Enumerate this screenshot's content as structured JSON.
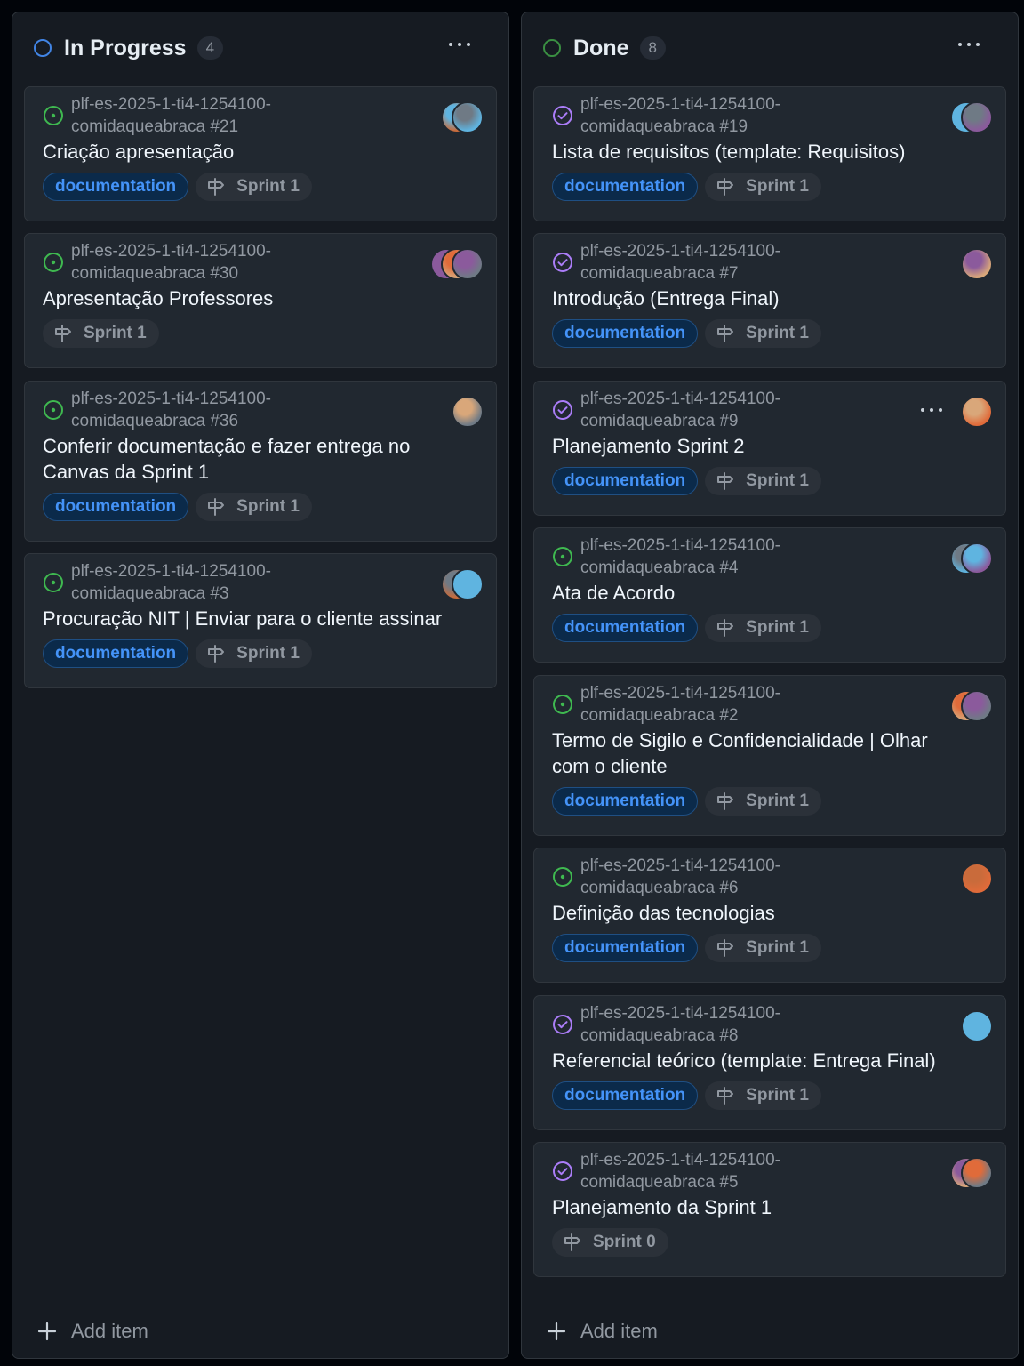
{
  "columns": [
    {
      "title": "In Progress",
      "count": "4",
      "status_color": "#4493f8",
      "add_label": "Add item",
      "cards": [
        {
          "repo": "plf-es-2025-1-ti4-1254100-",
          "repo2": "comidaqueabraca #21",
          "title": "Criação apresentação",
          "status": "open",
          "labels": [
            "documentation"
          ],
          "sprint": "Sprint 1",
          "avatars": 2
        },
        {
          "repo": "plf-es-2025-1-ti4-1254100-",
          "repo2": "comidaqueabraca #30",
          "title": "Apresentação Professores",
          "status": "open",
          "labels": [],
          "sprint": "Sprint 1",
          "avatars": 3
        },
        {
          "repo": "plf-es-2025-1-ti4-1254100-",
          "repo2": "comidaqueabraca #36",
          "title": "Conferir documentação e fazer entrega no Canvas da Sprint 1",
          "status": "open",
          "labels": [
            "documentation"
          ],
          "sprint": "Sprint 1",
          "avatars": 1
        },
        {
          "repo": "plf-es-2025-1-ti4-1254100-",
          "repo2": "comidaqueabraca #3",
          "title": "Procuração NIT | Enviar para o cliente assinar",
          "status": "open",
          "labels": [
            "documentation"
          ],
          "sprint": "Sprint 1",
          "avatars": 2
        }
      ]
    },
    {
      "title": "Done",
      "count": "8",
      "status_color": "#3fb950",
      "add_label": "Add item",
      "cards": [
        {
          "repo": "plf-es-2025-1-ti4-1254100-",
          "repo2": "comidaqueabraca #19",
          "title": "Lista de requisitos (template: Requisitos)",
          "status": "closed",
          "labels": [
            "documentation"
          ],
          "sprint": "Sprint 1",
          "avatars": 2
        },
        {
          "repo": "plf-es-2025-1-ti4-1254100-",
          "repo2": "comidaqueabraca #7",
          "title": "Introdução (Entrega Final)",
          "status": "closed",
          "labels": [
            "documentation"
          ],
          "sprint": "Sprint 1",
          "avatars": 1
        },
        {
          "repo": "plf-es-2025-1-ti4-1254100-",
          "repo2": "comidaqueabraca #9",
          "title": "Planejamento Sprint 2",
          "status": "closed",
          "labels": [
            "documentation"
          ],
          "sprint": "Sprint 1",
          "avatars": 1,
          "menu": true
        },
        {
          "repo": "plf-es-2025-1-ti4-1254100-",
          "repo2": "comidaqueabraca #4",
          "title": "Ata de Acordo",
          "status": "open",
          "labels": [
            "documentation"
          ],
          "sprint": "Sprint 1",
          "avatars": 2
        },
        {
          "repo": "plf-es-2025-1-ti4-1254100-",
          "repo2": "comidaqueabraca #2",
          "title": "Termo de Sigilo e Confidencialidade | Olhar com o cliente",
          "status": "open",
          "labels": [
            "documentation"
          ],
          "sprint": "Sprint 1",
          "avatars": 2
        },
        {
          "repo": "plf-es-2025-1-ti4-1254100-",
          "repo2": "comidaqueabraca #6",
          "title": "Definição das tecnologias",
          "status": "open",
          "labels": [
            "documentation"
          ],
          "sprint": "Sprint 1",
          "avatars": 1
        },
        {
          "repo": "plf-es-2025-1-ti4-1254100-",
          "repo2": "comidaqueabraca #8",
          "title": "Referencial teórico (template: Entrega Final)",
          "status": "closed",
          "labels": [
            "documentation"
          ],
          "sprint": "Sprint 1",
          "avatars": 1
        },
        {
          "repo": "plf-es-2025-1-ti4-1254100-",
          "repo2": "comidaqueabraca #5",
          "title": "Planejamento da Sprint 1",
          "status": "closed",
          "labels": [],
          "sprint": "Sprint 0",
          "avatars": 2
        }
      ]
    }
  ],
  "colors": {
    "open_issue": "#3fb950",
    "closed_issue": "#ab7df8",
    "label_text": "#4493f8"
  },
  "icons": {
    "open": "issue-opened-icon",
    "closed": "issue-closed-icon",
    "sprint": "milestone-icon",
    "add": "plus-icon",
    "menu": "kebab-horizontal-icon"
  }
}
